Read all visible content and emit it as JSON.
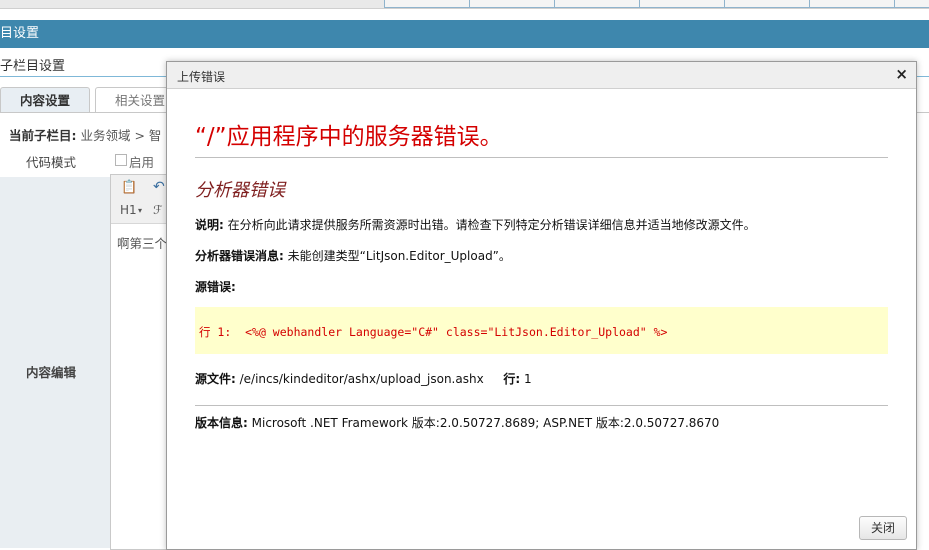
{
  "top_title": "目设置",
  "section_title": "子栏目设置",
  "tabs": [
    {
      "label": "内容设置"
    },
    {
      "label": "相关设置"
    }
  ],
  "breadcrumb": {
    "label": "当前子栏目:",
    "path": "业务领域 > 智"
  },
  "code_mode": {
    "label": "代码模式",
    "checkbox_label": "启用"
  },
  "content_edit_label": "内容编辑",
  "editor": {
    "heading_btn": "H1",
    "content_preview": "啊第三个"
  },
  "dialog": {
    "title": "上传错误",
    "close_glyph": "×",
    "heading": "“/”应用程序中的服务器错误。",
    "subheading": "分析器错误",
    "desc_label": "说明:",
    "desc_text": " 在分析向此请求提供服务所需资源时出错。请检查下列特定分析错误详细信息并适当地修改源文件。",
    "msg_label": "分析器错误消息:",
    "msg_text": " 未能创建类型“LitJson.Editor_Upload”。",
    "src_label": "源错误:",
    "code_line": "行 1:  <%@ webhandler Language=\"C#\" class=\"LitJson.Editor_Upload\" %>",
    "file_label": "源文件:",
    "file_text": " /e/incs/kindeditor/ashx/upload_json.ashx",
    "line_label": "行:",
    "line_text": " 1",
    "version_label": "版本信息:",
    "version_text": " Microsoft .NET Framework 版本:2.0.50727.8689; ASP.NET 版本:2.0.50727.8670",
    "close_button": "关闭"
  },
  "colors": {
    "header_blue": "#3e87ad",
    "error_red": "#d40000",
    "code_bg": "#ffffcc"
  }
}
